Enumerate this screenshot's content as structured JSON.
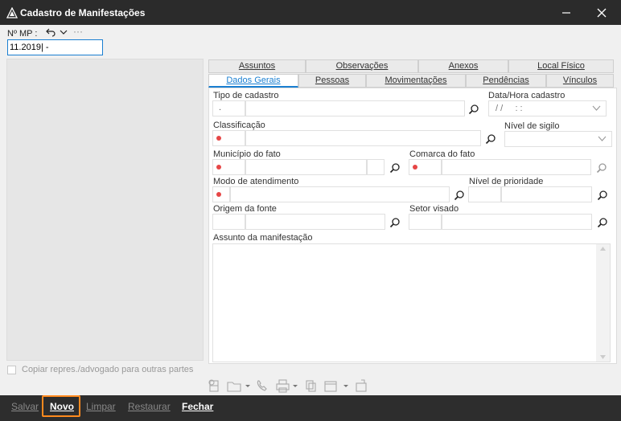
{
  "window": {
    "title": "Cadastro de Manifestações"
  },
  "mp": {
    "label": "Nº MP :",
    "value": "11.2019|        -",
    "more": "···"
  },
  "tabs_row1": [
    "Assuntos",
    "Observações",
    "Anexos",
    "Local Físico"
  ],
  "tabs_row2": [
    "Dados Gerais",
    "Pessoas",
    "Movimentações",
    "Pendências",
    "Vínculos"
  ],
  "form": {
    "tipo_cadastro": "Tipo de cadastro",
    "tipo_value": ".",
    "data_hora": "Data/Hora cadastro",
    "data_value": "/ /     : :",
    "classificacao": "Classificação",
    "nivel_sigilo": "Nível de sigilo",
    "municipio": "Município do fato",
    "comarca": "Comarca do fato",
    "modo": "Modo de atendimento",
    "nivel_prioridade": "Nível de prioridade",
    "origem": "Origem da fonte",
    "setor": "Setor visado",
    "assunto": "Assunto da manifestação"
  },
  "copy_label": "Copiar repres./advogado para outras partes",
  "bottom": {
    "salvar": "Salvar",
    "novo": "Novo",
    "limpar": "Limpar",
    "restaurar": "Restaurar",
    "fechar": "Fechar"
  }
}
